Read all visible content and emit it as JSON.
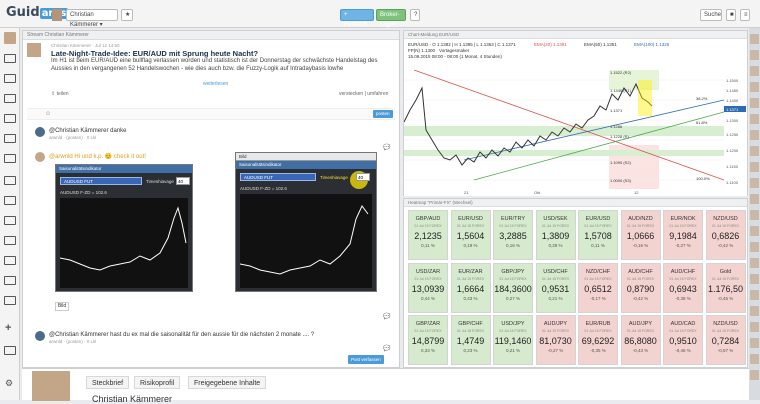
{
  "topbar": {
    "logo_main": "Guid",
    "logo_accent": "ants",
    "user_label": "Christian Kämmerer",
    "btn_1": "+ Herkunft",
    "btn_2": "Broker-Login",
    "search_label": "Suche"
  },
  "feed": {
    "header": "Stream Christian Kämmerer",
    "post": {
      "meta": "Christian Kämmerer · Jul 12 14:50",
      "title": "Late-Night-Trade-Idee: EUR/AUD mit Sprung heute Nacht?",
      "text": "Im H1 ist beim EUR/AUD eine bullflag verlassen worden und statistisch ist der Donnerstag der schwächste Handelstag des Aussies in den vergangenen 52 Handelswochen - wie dies auch bzw. die Fuzzy-Logik auf Intradaybasis lowhe",
      "more": "weiterlesen",
      "share": "teilen",
      "actions": "verstecken | umfahren",
      "post_btn": "posten"
    },
    "comments": [
      {
        "text": "@Christian Kämmerer danke",
        "meta": "arwnld · (posten) · 0 Lkl"
      },
      {
        "text": "@arwnld Hi und k.p. 😊 check it out!",
        "meta": ""
      },
      {
        "text": "@Christian Kämmerer hast du ex mal die saisonalität für den aussie für die nächsten 2 monate .... ?",
        "meta": "arwnld · (posten) · 0 Lkl"
      }
    ],
    "moderator": "(Moderator)",
    "bild": "Bild",
    "win1": {
      "title": "Saisonalitätsindikator",
      "select": "AUDUSD FUT",
      "label": "Timeshiavage",
      "input": "40",
      "row": "AUDUSD F-ZD = 102.6"
    },
    "win2": {
      "title": "Bild",
      "subtitle": "Saisonalitätsindikator",
      "select": "AUDUSD FUT",
      "label": "Timeshiavage",
      "input": "40",
      "row": "AUDUSD F-ZD = 102.6"
    },
    "post_reply_btn": "Post verfassen"
  },
  "bottom": {
    "tabs": [
      "Steckbrief",
      "Risikoprofil",
      "Freigegebene Inhalte"
    ],
    "name": "Christian Kämmerer"
  },
  "chart": {
    "header": "Chart-Meldung EUR/USD",
    "legend_1": "EUR/USD - O 1.1382 | H 1.1395 | L 1.1363 | C 1.1371",
    "legend_2": "FP(N) 1.1300 · Vortagesmaker",
    "legend_3": "15.09.2015 08:00 - 08:00 (1 Monat, 4 Stunden)",
    "levels": [
      "1.1522 (R2)",
      "1.1446 (R1)",
      "38.2%",
      "1.1371",
      "1.1286",
      "1.1228 (R)",
      "1.1090 (S2)",
      "1.0000 (S3)",
      "61.8%",
      "100.0%"
    ],
    "price_labels": [
      "1.1500",
      "1.1450",
      "1.1400",
      "1.1371",
      "1.1300",
      "1.1250",
      "1.1200",
      "1.1150",
      "1.1100"
    ],
    "x_labels": [
      "21",
      "Okt",
      "12"
    ],
    "ema_labels": [
      "EMA(20) 1.1391",
      "EMA(50) 1.1351",
      "EMA(100) 1.1325"
    ]
  },
  "heatmap": {
    "header": "Heatmap \"Primär-FX\" (Wechsel)",
    "cells": [
      {
        "pair": "GBP/AUD",
        "sub": "01 Jul 15 FOREX",
        "val": "2,1235",
        "pct": "0,11 %",
        "c": "g"
      },
      {
        "pair": "EUR/USD",
        "sub": "01 Jul 15 FOREX",
        "val": "1,5604",
        "pct": "0,19 %",
        "c": "g"
      },
      {
        "pair": "EUR/TRY",
        "sub": "01 Jul 15 FOREX",
        "val": "3,2885",
        "pct": "0,16 %",
        "c": "g"
      },
      {
        "pair": "USD/SEK",
        "sub": "01 Jul 15 FOREX",
        "val": "1,3809",
        "pct": "0,28 %",
        "c": "g"
      },
      {
        "pair": "EUR/USD",
        "sub": "01 Jul 15 FOREX",
        "val": "1,5708",
        "pct": "0,11 %",
        "c": "g"
      },
      {
        "pair": "AUD/NZD",
        "sub": "01 Jul 15 FOREX",
        "val": "1,0666",
        "pct": "-0,16 %",
        "c": "r"
      },
      {
        "pair": "EUR/NOK",
        "sub": "01 Jul 15 FOREX",
        "val": "9,1984",
        "pct": "-0,27 %",
        "c": "r"
      },
      {
        "pair": "NZD/USD",
        "sub": "01 Jul 15 FOREX",
        "val": "0,6826",
        "pct": "-0,42 %",
        "c": "r"
      },
      {
        "pair": "USD/ZAR",
        "sub": "01 Jul 15 FOREX",
        "val": "13,0939",
        "pct": "0,44 %",
        "c": "g"
      },
      {
        "pair": "EUR/ZAR",
        "sub": "01 Jul 15 FOREX",
        "val": "1,6664",
        "pct": "0,43 %",
        "c": "g"
      },
      {
        "pair": "GBP/JPY",
        "sub": "01 Jul 15 FOREX",
        "val": "184,3600",
        "pct": "0,27 %",
        "c": "g"
      },
      {
        "pair": "USD/CHF",
        "sub": "01 Jul 15 FOREX",
        "val": "0,9531",
        "pct": "0,21 %",
        "c": "g"
      },
      {
        "pair": "NZD/CHF",
        "sub": "01 Jul 15 FOREX",
        "val": "0,6512",
        "pct": "-0,17 %",
        "c": "r"
      },
      {
        "pair": "AUD/CHF",
        "sub": "01 Jul 15 FOREX",
        "val": "0,8790",
        "pct": "-0,42 %",
        "c": "r"
      },
      {
        "pair": "AUD/CHF",
        "sub": "01 Jul 15 FOREX",
        "val": "0,6943",
        "pct": "-0,38 %",
        "c": "r"
      },
      {
        "pair": "Gold",
        "sub": "01 Jul 15 FOREX",
        "val": "1.176,50",
        "pct": "-0,45 %",
        "c": "r"
      },
      {
        "pair": "GBP/ZAR",
        "sub": "01 Jul 15 FOREX",
        "val": "14,8799",
        "pct": "0,33 %",
        "c": "g"
      },
      {
        "pair": "GBP/CHF",
        "sub": "01 Jul 15 FOREX",
        "val": "1,4749",
        "pct": "0,23 %",
        "c": "g"
      },
      {
        "pair": "USD/JPY",
        "sub": "01 Jul 15 FOREX",
        "val": "119,1460",
        "pct": "0,21 %",
        "c": "g"
      },
      {
        "pair": "AUD/JPY",
        "sub": "01 Jul 15 FOREX",
        "val": "81,0730",
        "pct": "-0,27 %",
        "c": "r"
      },
      {
        "pair": "EUR/RUB",
        "sub": "01 Jul 15 FOREX",
        "val": "69,6292",
        "pct": "-0,35 %",
        "c": "r"
      },
      {
        "pair": "AUD/JPY",
        "sub": "01 Jul 15 FOREX",
        "val": "86,8080",
        "pct": "-0,43 %",
        "c": "r"
      },
      {
        "pair": "AUD/CAD",
        "sub": "01 Jul 15 FOREX",
        "val": "0,9510",
        "pct": "-0,46 %",
        "c": "r"
      },
      {
        "pair": "NZD/USD",
        "sub": "01 Jul 15 FOREX",
        "val": "0,7284",
        "pct": "-0,57 %",
        "c": "r"
      }
    ]
  }
}
